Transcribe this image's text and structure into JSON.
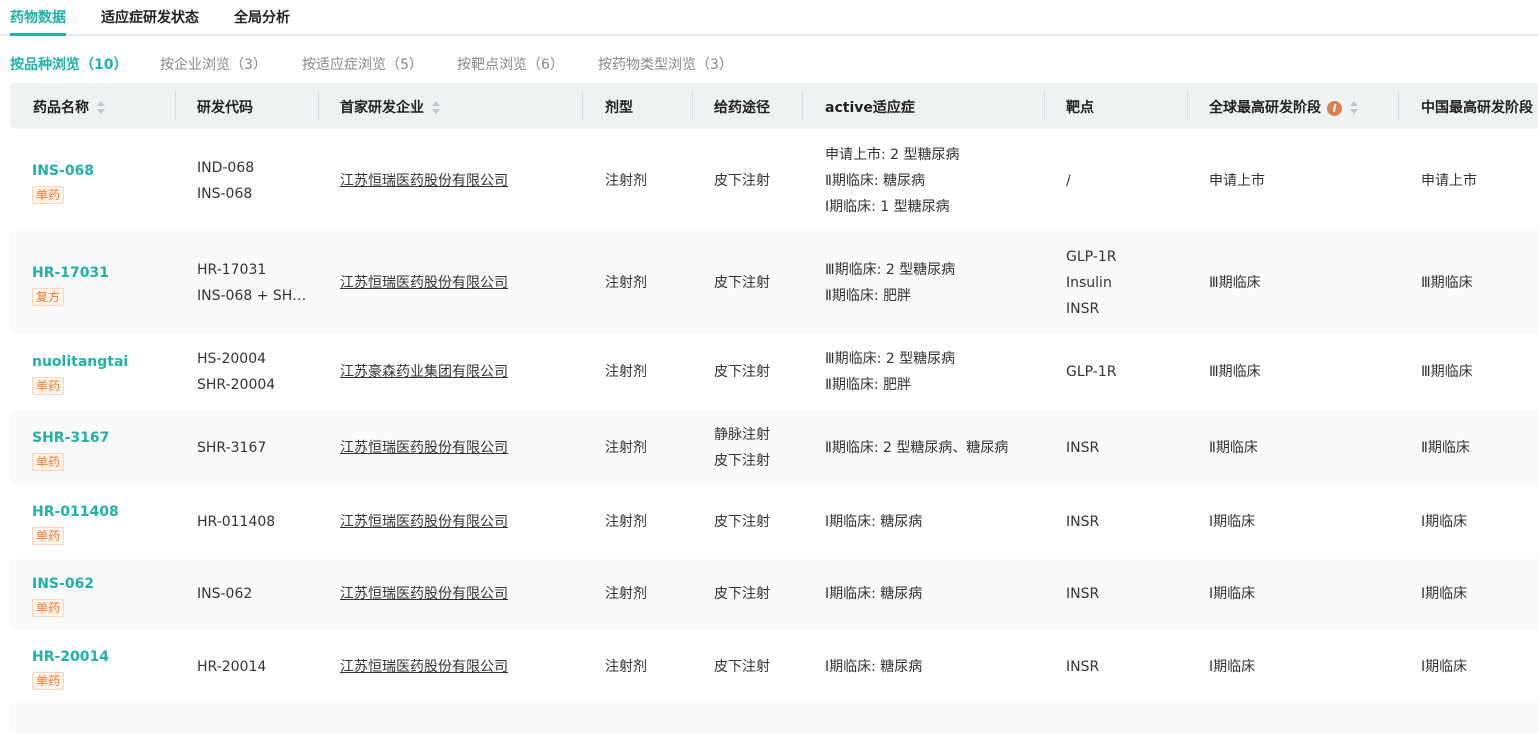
{
  "tabs": [
    "药物数据",
    "适应症研发状态",
    "全局分析"
  ],
  "subtabs": [
    "按品种浏览（10）",
    "按企业浏览（3）",
    "按适应症浏览（5）",
    "按靶点浏览（6）",
    "按药物类型浏览（3）"
  ],
  "columns": [
    "药品名称",
    "研发代码",
    "首家研发企业",
    "剂型",
    "给药途径",
    "active适应症",
    "靶点",
    "全球最高研发阶段",
    "中国最高研发阶段"
  ],
  "info_icon": "i",
  "rows": [
    {
      "name": "INS-068",
      "tag": "单药",
      "codes": [
        "IND-068",
        "INS-068"
      ],
      "company": "江苏恒瑞医药股份有限公司",
      "form": "注射剂",
      "routes": [
        "皮下注射"
      ],
      "indications": [
        "申请上市: 2 型糖尿病",
        "Ⅱ期临床: 糖尿病",
        "Ⅰ期临床: 1 型糖尿病"
      ],
      "targets": [
        "/"
      ],
      "global": "申请上市",
      "china": "申请上市"
    },
    {
      "name": "HR-17031",
      "tag": "复方",
      "codes": [
        "HR-17031",
        "INS-068 + SH…"
      ],
      "company": "江苏恒瑞医药股份有限公司",
      "form": "注射剂",
      "routes": [
        "皮下注射"
      ],
      "indications": [
        "Ⅲ期临床: 2 型糖尿病",
        "Ⅱ期临床: 肥胖"
      ],
      "targets": [
        "GLP-1R",
        "Insulin",
        "INSR"
      ],
      "global": "Ⅲ期临床",
      "china": "Ⅲ期临床"
    },
    {
      "name": "nuolitangtai",
      "tag": "单药",
      "codes": [
        "HS-20004",
        "SHR-20004"
      ],
      "company": "江苏豪森药业集团有限公司",
      "form": "注射剂",
      "routes": [
        "皮下注射"
      ],
      "indications": [
        "Ⅲ期临床: 2 型糖尿病",
        "Ⅱ期临床: 肥胖"
      ],
      "targets": [
        "GLP-1R"
      ],
      "global": "Ⅲ期临床",
      "china": "Ⅲ期临床"
    },
    {
      "name": "SHR-3167",
      "tag": "单药",
      "codes": [
        "SHR-3167"
      ],
      "company": "江苏恒瑞医药股份有限公司",
      "form": "注射剂",
      "routes": [
        "静脉注射",
        "皮下注射"
      ],
      "indications": [
        "Ⅱ期临床: 2 型糖尿病、糖尿病"
      ],
      "targets": [
        "INSR"
      ],
      "global": "Ⅱ期临床",
      "china": "Ⅱ期临床"
    },
    {
      "name": "HR-011408",
      "tag": "单药",
      "codes": [
        "HR-011408"
      ],
      "company": "江苏恒瑞医药股份有限公司",
      "form": "注射剂",
      "routes": [
        "皮下注射"
      ],
      "indications": [
        "Ⅰ期临床: 糖尿病"
      ],
      "targets": [
        "INSR"
      ],
      "global": "Ⅰ期临床",
      "china": "Ⅰ期临床"
    },
    {
      "name": "INS-062",
      "tag": "单药",
      "codes": [
        "INS-062"
      ],
      "company": "江苏恒瑞医药股份有限公司",
      "form": "注射剂",
      "routes": [
        "皮下注射"
      ],
      "indications": [
        "Ⅰ期临床: 糖尿病"
      ],
      "targets": [
        "INSR"
      ],
      "global": "Ⅰ期临床",
      "china": "Ⅰ期临床"
    },
    {
      "name": "HR-20014",
      "tag": "单药",
      "codes": [
        "HR-20014"
      ],
      "company": "江苏恒瑞医药股份有限公司",
      "form": "注射剂",
      "routes": [
        "皮下注射"
      ],
      "indications": [
        "Ⅰ期临床: 糖尿病"
      ],
      "targets": [
        "INSR"
      ],
      "global": "Ⅰ期临床",
      "china": "Ⅰ期临床"
    }
  ],
  "colors": {
    "accent": "#20b2a6",
    "tag": "#f07a2c",
    "info": "#d9804f"
  }
}
